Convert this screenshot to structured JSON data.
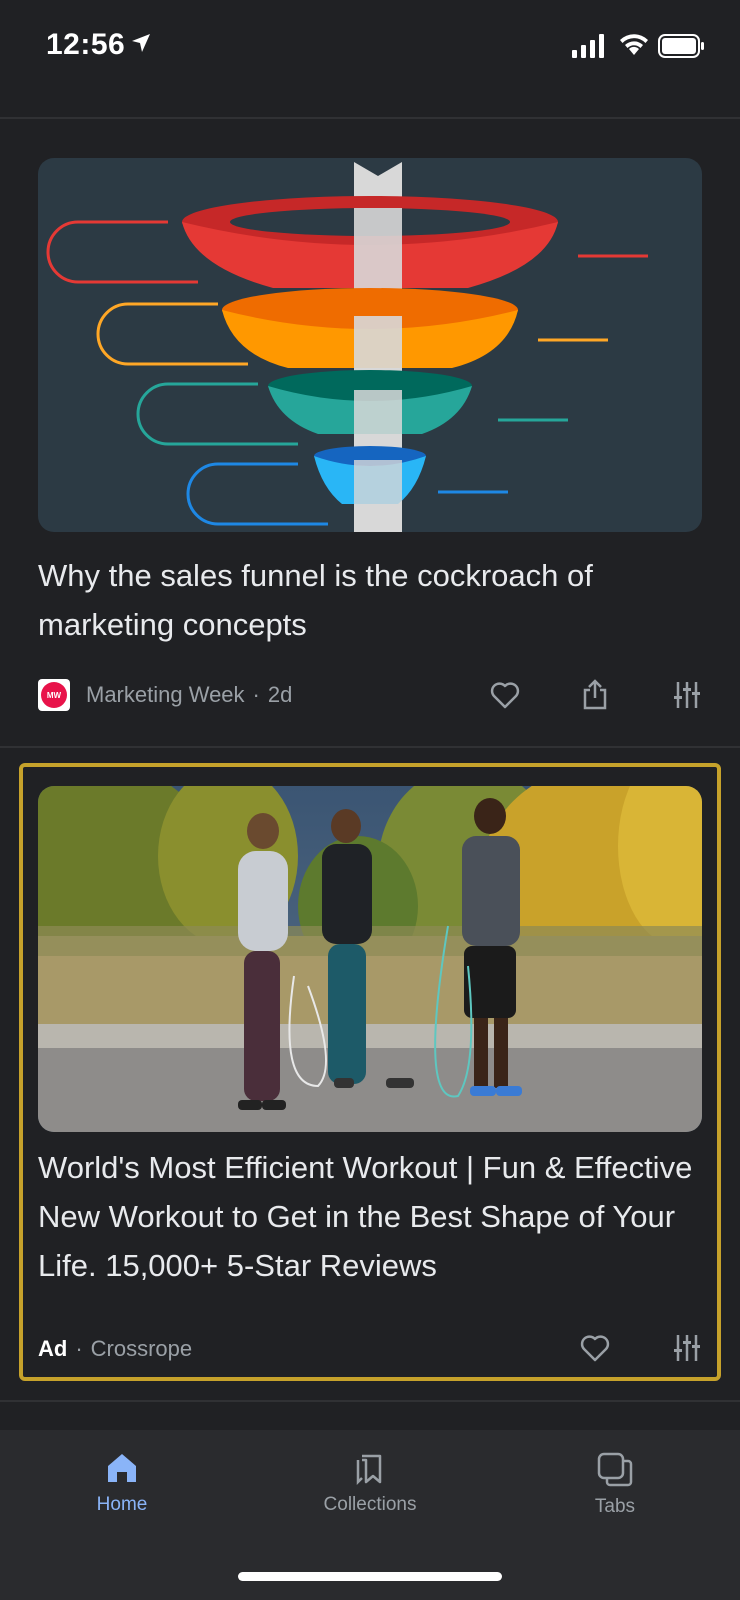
{
  "status_bar": {
    "time": "12:56"
  },
  "articles": [
    {
      "title": "Why the sales funnel is the cockroach of marketing concepts",
      "source_logo": "MW",
      "source": "Marketing Week",
      "age": "2d",
      "actions": [
        "heart-icon",
        "share-icon",
        "tune-icon"
      ]
    },
    {
      "title": "World's Most Efficient Workout | Fun & Effective New Workout to Get in the Best Shape of Your Life. 15,000+ 5-Star Reviews",
      "ad_label": "Ad",
      "source": "Crossrope",
      "actions": [
        "heart-icon",
        "tune-icon"
      ]
    }
  ],
  "nav": {
    "items": [
      {
        "label": "Home",
        "icon": "home-icon",
        "active": true
      },
      {
        "label": "Collections",
        "icon": "collections-icon",
        "active": false
      },
      {
        "label": "Tabs",
        "icon": "tabs-icon",
        "active": false
      }
    ]
  },
  "colors": {
    "background": "#202124",
    "accent": "#8ab4f8",
    "ad_highlight": "#c6a22b"
  }
}
